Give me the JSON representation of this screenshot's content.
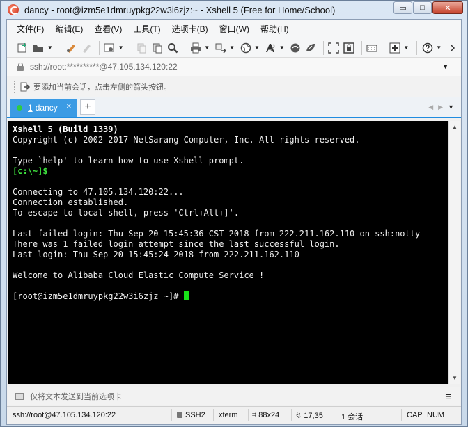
{
  "window": {
    "title": "dancy - root@izm5e1dmruypkg22w3i6zjz:~ - Xshell 5 (Free for Home/School)",
    "controls": {
      "minimize": "▭",
      "maximize": "□",
      "close": "✕"
    }
  },
  "menu": [
    "文件(F)",
    "编辑(E)",
    "查看(V)",
    "工具(T)",
    "选项卡(B)",
    "窗口(W)",
    "帮助(H)"
  ],
  "toolbar": {
    "icons": [
      "new-session-icon",
      "open-folder-icon",
      "connect-icon",
      "disconnect-icon",
      "properties-icon",
      "copy-icon",
      "paste-icon",
      "find-icon",
      "print-icon",
      "transfer-icon",
      "globe-icon",
      "font-icon",
      "xftp-icon",
      "xmanager-icon",
      "fullscreen-icon",
      "lock-screen-icon",
      "keyboard-icon",
      "add-icon",
      "help-icon",
      "more-icon"
    ]
  },
  "address": {
    "value": "ssh://root:**********@47.105.134.120:22"
  },
  "hint": {
    "text": "要添加当前会话，点击左侧的箭头按钮。"
  },
  "tabs": [
    {
      "number": "1",
      "label": "dancy",
      "close": "✕",
      "active": true
    }
  ],
  "tab_add": "+",
  "terminal": {
    "lines": [
      {
        "text": "Xshell 5 (Build 1339)",
        "style": "bold"
      },
      {
        "text": "Copyright (c) 2002-2017 NetSarang Computer, Inc. All rights reserved.",
        "style": ""
      },
      {
        "text": "",
        "style": ""
      },
      {
        "text": "Type `help' to learn how to use Xshell prompt.",
        "style": ""
      },
      {
        "text": "[c:\\~]$",
        "style": "green"
      },
      {
        "text": "",
        "style": ""
      },
      {
        "text": "Connecting to 47.105.134.120:22...",
        "style": ""
      },
      {
        "text": "Connection established.",
        "style": ""
      },
      {
        "text": "To escape to local shell, press 'Ctrl+Alt+]'.",
        "style": ""
      },
      {
        "text": "",
        "style": ""
      },
      {
        "text": "Last failed login: Thu Sep 20 15:45:36 CST 2018 from 222.211.162.110 on ssh:notty",
        "style": ""
      },
      {
        "text": "There was 1 failed login attempt since the last successful login.",
        "style": ""
      },
      {
        "text": "Last login: Thu Sep 20 15:45:24 2018 from 222.211.162.110",
        "style": ""
      },
      {
        "text": "",
        "style": ""
      },
      {
        "text": "Welcome to Alibaba Cloud Elastic Compute Service !",
        "style": ""
      },
      {
        "text": "",
        "style": ""
      },
      {
        "text": "[root@izm5e1dmruypkg22w3i6zjz ~]# ",
        "style": "prompt"
      }
    ]
  },
  "compose": {
    "placeholder": "仅将文本发送到当前选项卡"
  },
  "status": {
    "connection": "ssh://root@47.105.134.120:22",
    "protocol": "SSH2",
    "terminal_type": "xterm",
    "size": "88x24",
    "cursor_pos": "17,35",
    "sessions": "1 会话",
    "caps": "CAP",
    "num": "NUM"
  }
}
